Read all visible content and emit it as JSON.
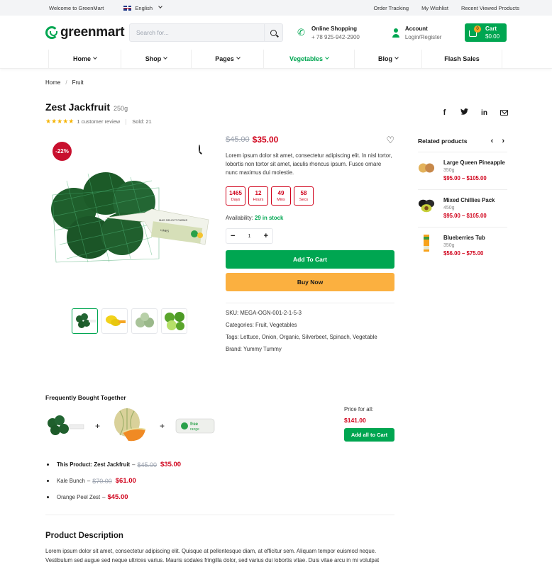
{
  "topbar": {
    "welcome": "Welcome to GreenMart",
    "language": "English",
    "links": [
      "Order Tracking",
      "My Wishlist",
      "Recent Viewed Products"
    ]
  },
  "header": {
    "logo": "greenmart",
    "search_placeholder": "Search for...",
    "phone": {
      "title": "Online Shopping",
      "number": "+ 78 925-942-2900"
    },
    "account": {
      "title": "Account",
      "sub": "Login/Register"
    },
    "cart": {
      "label": "Cart",
      "total": "$0.00",
      "count": "0"
    }
  },
  "nav": [
    {
      "label": "Home",
      "dropdown": true
    },
    {
      "label": "Shop",
      "dropdown": true
    },
    {
      "label": "Pages",
      "dropdown": true
    },
    {
      "label": "Vegetables",
      "dropdown": true,
      "active": true
    },
    {
      "label": "Blog",
      "dropdown": true
    },
    {
      "label": "Flash Sales",
      "dropdown": false
    }
  ],
  "breadcrumb": [
    "Home",
    "Fruit"
  ],
  "product": {
    "title": "Zest Jackfruit",
    "weight": "250g",
    "rating": 5,
    "stars": "★★★★★",
    "reviews": "1 customer review",
    "sold": "Sold: 21",
    "discount": "-22%",
    "old_price": "$45.00",
    "price": "$35.00",
    "description": "Lorem ipsum dolor sit amet, consectetur adipiscing elit. In nisl tortor, lobortis non tortor sit amet, iaculis rhoncus ipsum. Fusce ornare nunc maximus dui molestie.",
    "countdown": [
      {
        "value": "1465",
        "label": "Days"
      },
      {
        "value": "12",
        "label": "Hours"
      },
      {
        "value": "49",
        "label": "Mins"
      },
      {
        "value": "58",
        "label": "Secs"
      }
    ],
    "availability_label": "Availability:",
    "availability": "29 in stock",
    "quantity": "1",
    "add_to_cart": "Add To Cart",
    "buy_now": "Buy Now",
    "sku": "SKU: MEGA-OGN-001-2-1-5-3",
    "categories": "Categories:  Fruit, Vegetables",
    "tags": "Tags:  Lettuce, Onion, Organic, Silverbeet, Spinach, Vegetable",
    "brand": "Brand:  Yummy Tummy",
    "thumbnails": [
      "limes-bag",
      "lemons",
      "custard-apples",
      "limes-cut"
    ]
  },
  "share": [
    "facebook",
    "twitter",
    "linkedin",
    "email"
  ],
  "related": {
    "title": "Related products",
    "items": [
      {
        "name": "Large Queen Pineapple",
        "weight": "350g",
        "price": "$95.00 – $105.00"
      },
      {
        "name": "Mixed Chillies Pack",
        "weight": "450g",
        "price": "$95.00 – $105.00"
      },
      {
        "name": "Blueberries Tub",
        "weight": "350g",
        "price": "$56.00 – $75.00"
      }
    ]
  },
  "fbt": {
    "title": "Frequently Bought Together",
    "items": [
      {
        "label": "This Product: Zest Jackfruit",
        "old": "$45.00",
        "price": "$35.00"
      },
      {
        "label": "Kale Bunch",
        "old": "$70.00",
        "price": "$61.00"
      },
      {
        "label": "Orange Peel Zest",
        "old": "",
        "price": "$45.00"
      }
    ],
    "price_label": "Price for all:",
    "total": "$141.00",
    "button": "Add all to Cart"
  },
  "description": {
    "title": "Product Description",
    "text": "Lorem ipsum dolor sit amet, consectetur adipiscing elit. Quisque at pellentesque diam, at efficitur sem. Aliquam tempor euismod neque. Vestibulum sed augue sed neque ultrices varius. Mauris sodales fringilla dolor, sed varius dui lobortis vitae. Duis vitae arcu in mi volutpat"
  }
}
